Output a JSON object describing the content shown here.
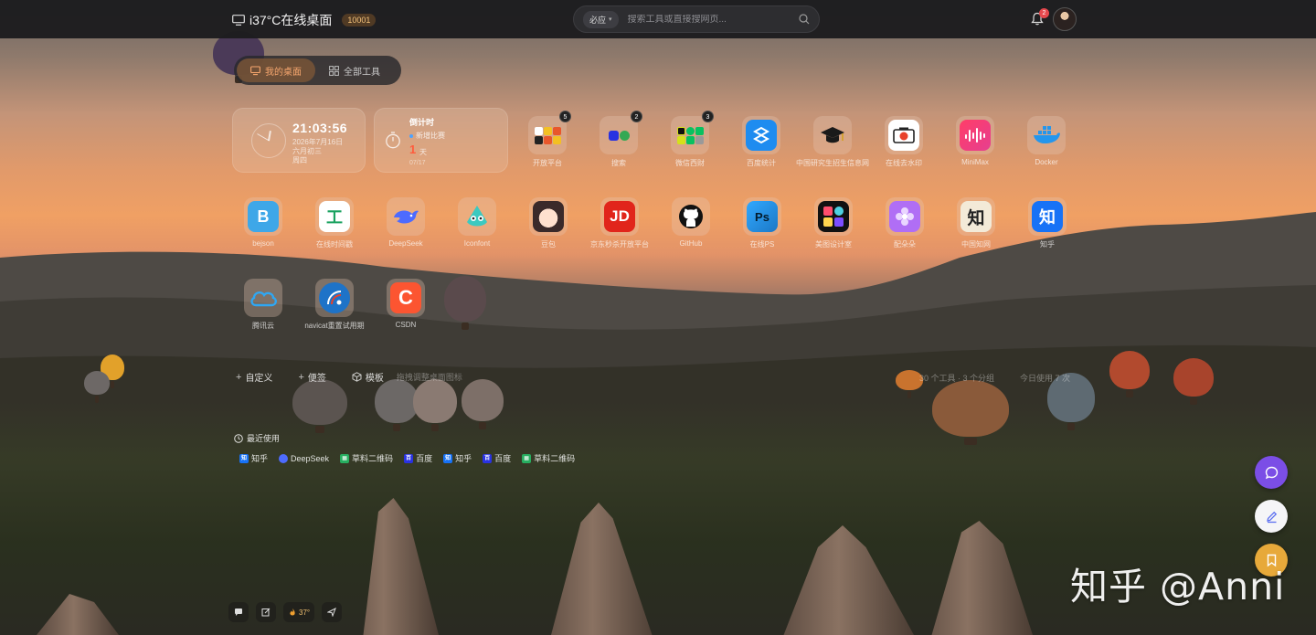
{
  "header": {
    "site_name": "i37°C在线桌面",
    "badge": "10001",
    "search_engine": "必应",
    "search_placeholder": "搜索工具或直接搜网页...",
    "notification_count": "2"
  },
  "tabs": [
    {
      "label": "我的桌面",
      "active": true
    },
    {
      "label": "全部工具",
      "active": false
    }
  ],
  "clock_widget": {
    "time": "21:03:56",
    "date": "2026年7月16日",
    "lunar": "六月初三",
    "weekday": "周四"
  },
  "countdown_widget": {
    "title": "倒计时",
    "event": "新增比赛",
    "days": "1",
    "unit": "天",
    "date": "07/17"
  },
  "apps": [
    {
      "label": "开放平台",
      "badge": "5",
      "icon": "open-platform-icon"
    },
    {
      "label": "搜索",
      "badge": "2",
      "icon": "search-group-icon"
    },
    {
      "label": "微信西财",
      "badge": "3",
      "icon": "wechat-group-icon"
    },
    {
      "label": "百度统计",
      "badge": "",
      "icon": "baidu-stats-icon"
    },
    {
      "label": "中国研究生招生信息网",
      "badge": "",
      "icon": "graduation-cap-icon"
    },
    {
      "label": "在线去水印",
      "badge": "",
      "icon": "camera-icon"
    },
    {
      "label": "MiniMax",
      "badge": "",
      "icon": "minimax-icon"
    },
    {
      "label": "Docker",
      "badge": "",
      "icon": "docker-icon"
    },
    {
      "label": "bejson",
      "badge": "",
      "icon": "bejson-icon"
    },
    {
      "label": "在线时间戳",
      "badge": "",
      "icon": "timestamp-icon"
    },
    {
      "label": "DeepSeek",
      "badge": "",
      "icon": "deepseek-icon"
    },
    {
      "label": "Iconfont",
      "badge": "",
      "icon": "iconfont-icon"
    },
    {
      "label": "豆包",
      "badge": "",
      "icon": "doubao-icon"
    },
    {
      "label": "京东秒杀开放平台",
      "badge": "",
      "icon": "jd-icon"
    },
    {
      "label": "GitHub",
      "badge": "",
      "icon": "github-icon"
    },
    {
      "label": "在线PS",
      "badge": "",
      "icon": "photoshop-icon"
    },
    {
      "label": "美图设计室",
      "badge": "",
      "icon": "meitu-icon"
    },
    {
      "label": "配朵朵",
      "badge": "",
      "icon": "flower-icon"
    },
    {
      "label": "中国知网",
      "badge": "",
      "icon": "cnki-icon"
    },
    {
      "label": "知乎",
      "badge": "",
      "icon": "zhihu-icon"
    },
    {
      "label": "腾讯云",
      "badge": "",
      "icon": "tencent-cloud-icon"
    },
    {
      "label": "navicat重置试用期",
      "badge": "",
      "icon": "navicat-icon"
    },
    {
      "label": "CSDN",
      "badge": "",
      "icon": "csdn-icon"
    }
  ],
  "toolbar": {
    "custom_label": "自定义",
    "sticky_label": "便签",
    "template_label": "模板",
    "hint": "拖拽调整桌面图标",
    "stats_tools": "30 个工具 · 3 个分组",
    "stats_usage": "今日使用 7 次"
  },
  "recent": {
    "title": "最近使用",
    "items": [
      {
        "label": "知乎",
        "icon": "zhihu-icon",
        "color": "#1772f6"
      },
      {
        "label": "DeepSeek",
        "icon": "deepseek-icon",
        "color": "#4d6bfe"
      },
      {
        "label": "草料二维码",
        "icon": "qrcode-icon",
        "color": "#27ae60"
      },
      {
        "label": "百度",
        "icon": "baidu-icon",
        "color": "#2932e1"
      },
      {
        "label": "知乎",
        "icon": "zhihu-icon",
        "color": "#1772f6"
      },
      {
        "label": "百度",
        "icon": "baidu-icon",
        "color": "#2932e1"
      },
      {
        "label": "草料二维码",
        "icon": "qrcode-icon",
        "color": "#27ae60"
      }
    ]
  },
  "minibar": {
    "temperature": "37°"
  },
  "watermark": "知乎 @Anni",
  "colors": {
    "accent": "#f6a66e",
    "fab_chat": "#7b4ee6",
    "fab_save": "#e7a93a",
    "countdown_number": "#ff5b3c"
  }
}
